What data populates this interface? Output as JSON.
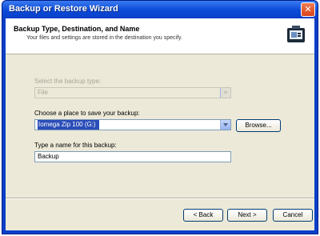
{
  "window": {
    "title": "Backup or Restore Wizard",
    "close_glyph": "✕"
  },
  "header": {
    "title": "Backup Type, Destination, and Name",
    "subtitle": "Your files and settings are stored in the destination you specify.",
    "icon": "backup-wizard-icon"
  },
  "form": {
    "backup_type_label": "Select the backup type:",
    "backup_type_value": "File",
    "place_label": "Choose a place to save your backup:",
    "place_value": "Iomega Zip 100 (G:)",
    "browse_label": "Browse...",
    "name_label": "Type a name for this backup:",
    "name_value": "Backup"
  },
  "footer": {
    "back_label": "< Back",
    "next_label": "Next >",
    "cancel_label": "Cancel"
  },
  "colors": {
    "titlebar": "#0a3fc8",
    "close": "#d8431c",
    "dialog_bg": "#ece9d8",
    "selection": "#2b4db8"
  }
}
